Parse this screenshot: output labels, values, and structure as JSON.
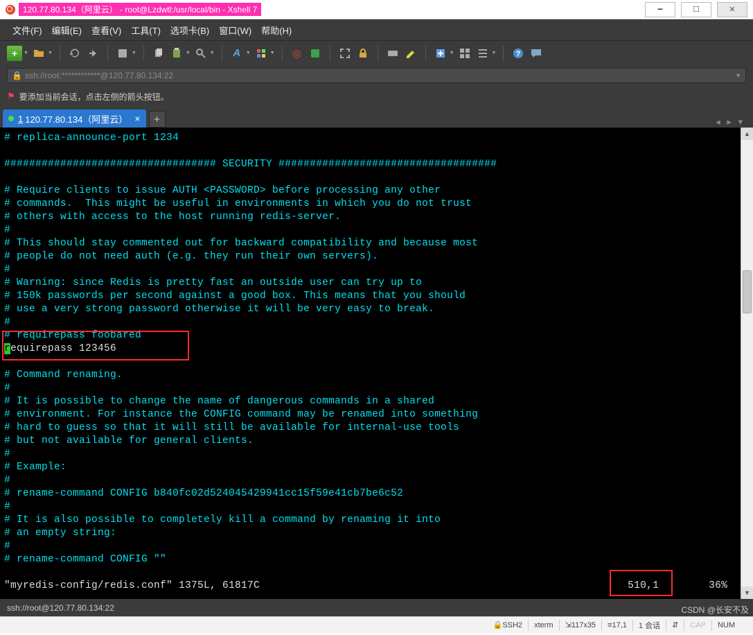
{
  "title": "120.77.80.134（阿里云） - root@Lzdwtl:/usr/local/bin - Xshell 7",
  "menubar": [
    "文件(F)",
    "编辑(E)",
    "查看(V)",
    "工具(T)",
    "选项卡(B)",
    "窗口(W)",
    "帮助(H)"
  ],
  "address": "ssh://root:************@120.77.80.134:22",
  "hint": "要添加当前会话，点击左侧的箭头按钮。",
  "tab": {
    "num": "1",
    "label": "120.77.80.134（阿里云）"
  },
  "terminal_lines": [
    "# replica-announce-port 1234",
    "",
    "################################## SECURITY ###################################",
    "",
    "# Require clients to issue AUTH <PASSWORD> before processing any other",
    "# commands.  This might be useful in environments in which you do not trust",
    "# others with access to the host running redis-server.",
    "#",
    "# This should stay commented out for backward compatibility and because most",
    "# people do not need auth (e.g. they run their own servers).",
    "#",
    "# Warning: since Redis is pretty fast an outside user can try up to",
    "# 150k passwords per second against a good box. This means that you should",
    "# use a very strong password otherwise it will be very easy to break.",
    "#",
    "# requirepass foobared"
  ],
  "insert_line_head": "r",
  "insert_line_rest": "equirepass 123456",
  "terminal_lines2": [
    "",
    "# Command renaming.",
    "#",
    "# It is possible to change the name of dangerous commands in a shared",
    "# environment. For instance the CONFIG command may be renamed into something",
    "# hard to guess so that it will still be available for internal-use tools",
    "# but not available for general clients.",
    "#",
    "# Example:",
    "#",
    "# rename-command CONFIG b840fc02d524045429941cc15f59e41cb7be6c52",
    "#",
    "# It is also possible to completely kill a command by renaming it into",
    "# an empty string:",
    "#",
    "# rename-command CONFIG \"\"",
    ""
  ],
  "vim_file": "\"myredis-config/redis.conf\" 1375L, 61817C",
  "vim_pos": "510,1",
  "vim_pct": "36%",
  "status_left": "ssh://root@120.77.80.134:22",
  "statusbar": {
    "proto": "SSH2",
    "term": "xterm",
    "size": "117x35",
    "cursor": "17,1",
    "session": "1 会话",
    "caps": "CAP",
    "num": "NUM"
  },
  "watermark": "CSDN @长安不及",
  "colors": {
    "comment": "#03e0ee",
    "titlehl": "#ff2fb1",
    "tab": "#2a78d0",
    "annot": "#ff2a2a"
  }
}
